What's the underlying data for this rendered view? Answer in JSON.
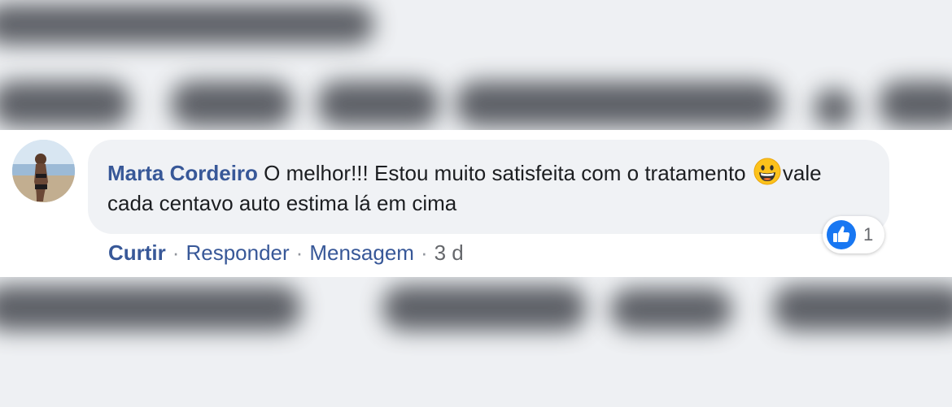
{
  "comment": {
    "author": "Marta Cordeiro",
    "text_before_emoji": "O melhor!!! Estou muito satisfeita com o tratamento ",
    "emoji": "grinning-face-emoji",
    "text_after_emoji": "vale cada centavo auto estima lá em cima"
  },
  "reactions": {
    "icon": "like-icon",
    "count": "1"
  },
  "actions": {
    "like_label": "Curtir",
    "reply_label": "Responder",
    "message_label": "Mensagem",
    "separator": "·",
    "timestamp": "3 d"
  },
  "colors": {
    "author_link": "#385898",
    "bubble_bg": "#f0f2f5",
    "like_blue": "#1877f2",
    "meta_gray": "#65676b"
  }
}
